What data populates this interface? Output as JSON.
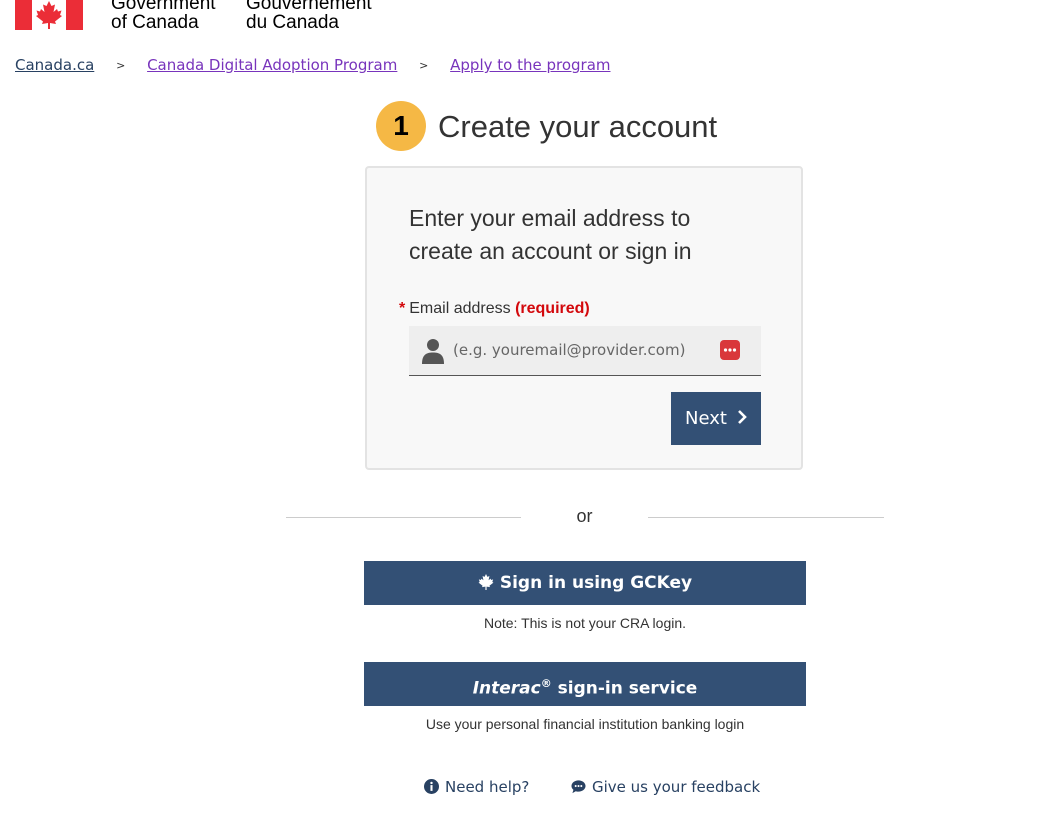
{
  "header": {
    "signature_en_line1": "Government",
    "signature_en_line2": "of Canada",
    "signature_fr_line1": "Gouvernement",
    "signature_fr_line2": "du Canada",
    "flag_icon": "canada-flag-icon"
  },
  "breadcrumb": {
    "items": [
      {
        "label": "Canada.ca"
      },
      {
        "label": "Canada Digital Adoption Program"
      },
      {
        "label": "Apply to the program"
      }
    ],
    "separator": ">"
  },
  "page": {
    "step_number": "1",
    "title": "Create your account"
  },
  "form": {
    "heading": "Enter your email address to create an account or sign in",
    "required_marker": "*",
    "email_label": "Email address",
    "required_text": "(required)",
    "email_placeholder": "(e.g. youremail@provider.com)",
    "email_value": "",
    "next_label": "Next",
    "next_icon": "chevron-right-icon"
  },
  "divider": {
    "or_text": "or"
  },
  "signin": {
    "gckey_label": "Sign in using GCKey",
    "gckey_icon": "maple-leaf-icon",
    "gckey_note": "Note: This is not your CRA login.",
    "interac_brand": "Interac",
    "interac_reg": "®",
    "interac_rest": " sign-in service",
    "interac_note": "Use your personal financial institution banking login"
  },
  "footer": {
    "help_label": "Need help?",
    "help_icon": "info-icon",
    "feedback_label": "Give us your feedback",
    "feedback_icon": "comment-icon"
  },
  "colors": {
    "primary": "#335075",
    "link": "#284162",
    "visited_link": "#7834bc",
    "required": "#d3080c",
    "step_badge": "#f5b845",
    "flag_red": "#eb2d37"
  }
}
